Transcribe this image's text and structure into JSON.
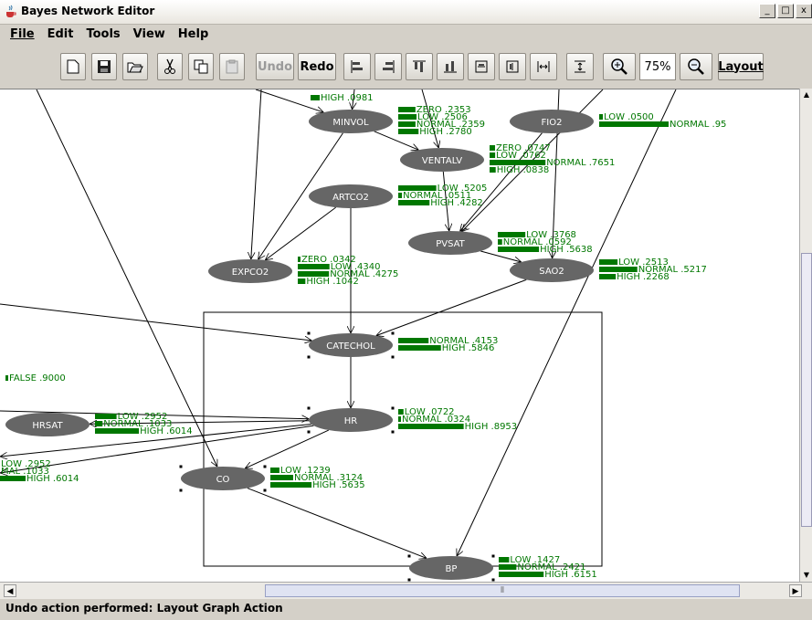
{
  "window": {
    "title": "Bayes Network Editor",
    "icon": "java-cup-icon",
    "controls": [
      "_",
      "□",
      "x"
    ]
  },
  "menubar": [
    {
      "label": "File",
      "mnemonic": "F"
    },
    {
      "label": "Edit",
      "mnemonic": "E"
    },
    {
      "label": "Tools",
      "mnemonic": "T"
    },
    {
      "label": "View",
      "mnemonic": "V"
    },
    {
      "label": "Help",
      "mnemonic": "H"
    }
  ],
  "toolbar": {
    "undo_label": "Undo",
    "redo_label": "Redo",
    "zoom_value": "75%",
    "layout_label": "Layout",
    "icons": [
      "new-file-icon",
      "save-icon",
      "open-icon",
      "cut-icon",
      "copy-icon",
      "paste-icon",
      "align-left-icon",
      "align-right-icon",
      "align-top-icon",
      "align-bottom-icon",
      "center-horizontal-icon",
      "center-vertical-icon",
      "space-horizontal-icon",
      "space-vertical-icon",
      "zoom-in-icon",
      "zoom-out-icon"
    ],
    "undo_enabled": false,
    "paste_enabled": false
  },
  "graph": {
    "colors": {
      "node_fill": "#666666",
      "bar": "#007700",
      "edge": "#000000"
    },
    "nodes": [
      {
        "id": "MINVOL",
        "label": "MINVOL",
        "selected": false,
        "states": [
          {
            "name": "ZERO",
            "prob": ".2353",
            "text": "ZERO .2353"
          },
          {
            "name": "LOW",
            "prob": ".2506",
            "text": "LOW .2506"
          },
          {
            "name": "NORMAL",
            "prob": ".2359",
            "text": "NORMAL .2359"
          },
          {
            "name": "HIGH",
            "prob": ".2780",
            "text": "HIGH .2780"
          }
        ]
      },
      {
        "id": "FIO2",
        "label": "FIO2",
        "selected": false,
        "states": [
          {
            "name": "LOW",
            "prob": ".0500",
            "text": "LOW .0500"
          },
          {
            "name": "NORMAL",
            "prob": ".95",
            "text": "NORMAL .95"
          }
        ]
      },
      {
        "id": "VENTALV",
        "label": "VENTALV",
        "selected": false,
        "states": [
          {
            "name": "ZERO",
            "prob": ".0747",
            "text": "ZERO .0747"
          },
          {
            "name": "LOW",
            "prob": ".0762",
            "text": "LOW .0762"
          },
          {
            "name": "NORMAL",
            "prob": ".7651",
            "text": "NORMAL .7651"
          },
          {
            "name": "HIGH",
            "prob": ".0838",
            "text": "HIGH .0838"
          }
        ]
      },
      {
        "id": "ARTCO2",
        "label": "ARTCO2",
        "selected": false,
        "states": [
          {
            "name": "LOW",
            "prob": ".5205",
            "text": "LOW .5205"
          },
          {
            "name": "NORMAL",
            "prob": ".0511",
            "text": "NORMAL .0511"
          },
          {
            "name": "HIGH",
            "prob": ".4282",
            "text": "HIGH .4282"
          }
        ]
      },
      {
        "id": "PVSAT",
        "label": "PVSAT",
        "selected": false,
        "states": [
          {
            "name": "LOW",
            "prob": ".3768",
            "text": "LOW .3768"
          },
          {
            "name": "NORMAL",
            "prob": ".0592",
            "text": "NORMAL .0592"
          },
          {
            "name": "HIGH",
            "prob": ".5638",
            "text": "HIGH .5638"
          }
        ]
      },
      {
        "id": "EXPCO2",
        "label": "EXPCO2",
        "selected": false,
        "states": [
          {
            "name": "ZERO",
            "prob": ".0342",
            "text": "ZERO .0342"
          },
          {
            "name": "LOW",
            "prob": ".4340",
            "text": "LOW .4340"
          },
          {
            "name": "NORMAL",
            "prob": ".4275",
            "text": "NORMAL .4275"
          },
          {
            "name": "HIGH",
            "prob": ".1042",
            "text": "HIGH .1042"
          }
        ]
      },
      {
        "id": "SAO2",
        "label": "SAO2",
        "selected": false,
        "states": [
          {
            "name": "LOW",
            "prob": ".2513",
            "text": "LOW .2513"
          },
          {
            "name": "NORMAL",
            "prob": ".5217",
            "text": "NORMAL .5217"
          },
          {
            "name": "HIGH",
            "prob": ".2268",
            "text": "HIGH .2268"
          }
        ]
      },
      {
        "id": "CATECHOL",
        "label": "CATECHOL",
        "selected": true,
        "states": [
          {
            "name": "NORMAL",
            "prob": ".4153",
            "text": "NORMAL .4153"
          },
          {
            "name": "HIGH",
            "prob": ".5846",
            "text": "HIGH .5846"
          }
        ]
      },
      {
        "id": "HR",
        "label": "HR",
        "selected": true,
        "states": [
          {
            "name": "LOW",
            "prob": ".0722",
            "text": "LOW .0722"
          },
          {
            "name": "NORMAL",
            "prob": ".0324",
            "text": "NORMAL .0324"
          },
          {
            "name": "HIGH",
            "prob": ".8953",
            "text": "HIGH .8953"
          }
        ]
      },
      {
        "id": "HRSAT",
        "label": "HRSAT",
        "selected": false,
        "states": [
          {
            "name": "LOW",
            "prob": ".2952",
            "text": "LOW .2952"
          },
          {
            "name": "NORMAL",
            "prob": ".1033",
            "text": "NORMAL .1033"
          },
          {
            "name": "HIGH",
            "prob": ".6014",
            "text": "HIGH .6014"
          }
        ]
      },
      {
        "id": "CO",
        "label": "CO",
        "selected": true,
        "states": [
          {
            "name": "LOW",
            "prob": ".1239",
            "text": "LOW .1239"
          },
          {
            "name": "NORMAL",
            "prob": ".3124",
            "text": "NORMAL .3124"
          },
          {
            "name": "HIGH",
            "prob": ".5635",
            "text": "HIGH .5635"
          }
        ]
      },
      {
        "id": "BP",
        "label": "BP",
        "selected": true,
        "states": [
          {
            "name": "LOW",
            "prob": ".1427",
            "text": "LOW .1427"
          },
          {
            "name": "NORMAL",
            "prob": ".2421",
            "text": "NORMAL .2421"
          },
          {
            "name": "HIGH",
            "prob": ".6151",
            "text": "HIGH .6151"
          }
        ]
      }
    ],
    "offscreen_labels": [
      {
        "id": "top-high",
        "text": "HIGH .0981"
      },
      {
        "id": "false",
        "text": "FALSE .9000"
      },
      {
        "id": "left-low",
        "text": "LOW .2952"
      },
      {
        "id": "left-normal",
        "text": "MAL .1033"
      },
      {
        "id": "left-high",
        "text": "HIGH .6014"
      }
    ]
  },
  "status": {
    "message": "Undo action performed: Layout Graph Action"
  }
}
